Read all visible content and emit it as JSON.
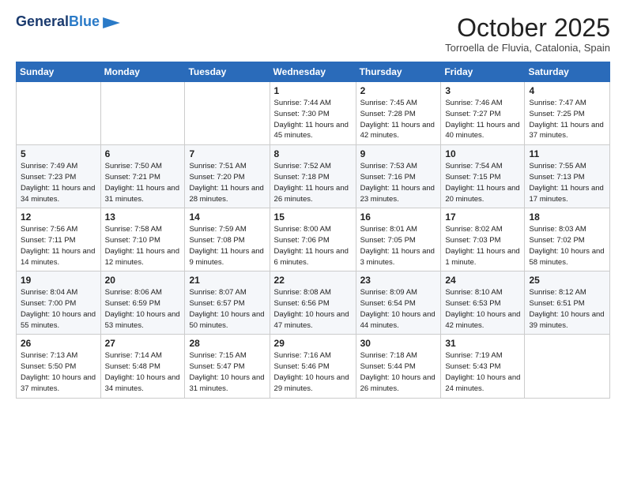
{
  "header": {
    "logo_line1": "General",
    "logo_line2": "Blue",
    "month": "October 2025",
    "location": "Torroella de Fluvia, Catalonia, Spain"
  },
  "weekdays": [
    "Sunday",
    "Monday",
    "Tuesday",
    "Wednesday",
    "Thursday",
    "Friday",
    "Saturday"
  ],
  "weeks": [
    [
      {
        "day": "",
        "detail": ""
      },
      {
        "day": "",
        "detail": ""
      },
      {
        "day": "",
        "detail": ""
      },
      {
        "day": "1",
        "detail": "Sunrise: 7:44 AM\nSunset: 7:30 PM\nDaylight: 11 hours\nand 45 minutes."
      },
      {
        "day": "2",
        "detail": "Sunrise: 7:45 AM\nSunset: 7:28 PM\nDaylight: 11 hours\nand 42 minutes."
      },
      {
        "day": "3",
        "detail": "Sunrise: 7:46 AM\nSunset: 7:27 PM\nDaylight: 11 hours\nand 40 minutes."
      },
      {
        "day": "4",
        "detail": "Sunrise: 7:47 AM\nSunset: 7:25 PM\nDaylight: 11 hours\nand 37 minutes."
      }
    ],
    [
      {
        "day": "5",
        "detail": "Sunrise: 7:49 AM\nSunset: 7:23 PM\nDaylight: 11 hours\nand 34 minutes."
      },
      {
        "day": "6",
        "detail": "Sunrise: 7:50 AM\nSunset: 7:21 PM\nDaylight: 11 hours\nand 31 minutes."
      },
      {
        "day": "7",
        "detail": "Sunrise: 7:51 AM\nSunset: 7:20 PM\nDaylight: 11 hours\nand 28 minutes."
      },
      {
        "day": "8",
        "detail": "Sunrise: 7:52 AM\nSunset: 7:18 PM\nDaylight: 11 hours\nand 26 minutes."
      },
      {
        "day": "9",
        "detail": "Sunrise: 7:53 AM\nSunset: 7:16 PM\nDaylight: 11 hours\nand 23 minutes."
      },
      {
        "day": "10",
        "detail": "Sunrise: 7:54 AM\nSunset: 7:15 PM\nDaylight: 11 hours\nand 20 minutes."
      },
      {
        "day": "11",
        "detail": "Sunrise: 7:55 AM\nSunset: 7:13 PM\nDaylight: 11 hours\nand 17 minutes."
      }
    ],
    [
      {
        "day": "12",
        "detail": "Sunrise: 7:56 AM\nSunset: 7:11 PM\nDaylight: 11 hours\nand 14 minutes."
      },
      {
        "day": "13",
        "detail": "Sunrise: 7:58 AM\nSunset: 7:10 PM\nDaylight: 11 hours\nand 12 minutes."
      },
      {
        "day": "14",
        "detail": "Sunrise: 7:59 AM\nSunset: 7:08 PM\nDaylight: 11 hours\nand 9 minutes."
      },
      {
        "day": "15",
        "detail": "Sunrise: 8:00 AM\nSunset: 7:06 PM\nDaylight: 11 hours\nand 6 minutes."
      },
      {
        "day": "16",
        "detail": "Sunrise: 8:01 AM\nSunset: 7:05 PM\nDaylight: 11 hours\nand 3 minutes."
      },
      {
        "day": "17",
        "detail": "Sunrise: 8:02 AM\nSunset: 7:03 PM\nDaylight: 11 hours\nand 1 minute."
      },
      {
        "day": "18",
        "detail": "Sunrise: 8:03 AM\nSunset: 7:02 PM\nDaylight: 10 hours\nand 58 minutes."
      }
    ],
    [
      {
        "day": "19",
        "detail": "Sunrise: 8:04 AM\nSunset: 7:00 PM\nDaylight: 10 hours\nand 55 minutes."
      },
      {
        "day": "20",
        "detail": "Sunrise: 8:06 AM\nSunset: 6:59 PM\nDaylight: 10 hours\nand 53 minutes."
      },
      {
        "day": "21",
        "detail": "Sunrise: 8:07 AM\nSunset: 6:57 PM\nDaylight: 10 hours\nand 50 minutes."
      },
      {
        "day": "22",
        "detail": "Sunrise: 8:08 AM\nSunset: 6:56 PM\nDaylight: 10 hours\nand 47 minutes."
      },
      {
        "day": "23",
        "detail": "Sunrise: 8:09 AM\nSunset: 6:54 PM\nDaylight: 10 hours\nand 44 minutes."
      },
      {
        "day": "24",
        "detail": "Sunrise: 8:10 AM\nSunset: 6:53 PM\nDaylight: 10 hours\nand 42 minutes."
      },
      {
        "day": "25",
        "detail": "Sunrise: 8:12 AM\nSunset: 6:51 PM\nDaylight: 10 hours\nand 39 minutes."
      }
    ],
    [
      {
        "day": "26",
        "detail": "Sunrise: 7:13 AM\nSunset: 5:50 PM\nDaylight: 10 hours\nand 37 minutes."
      },
      {
        "day": "27",
        "detail": "Sunrise: 7:14 AM\nSunset: 5:48 PM\nDaylight: 10 hours\nand 34 minutes."
      },
      {
        "day": "28",
        "detail": "Sunrise: 7:15 AM\nSunset: 5:47 PM\nDaylight: 10 hours\nand 31 minutes."
      },
      {
        "day": "29",
        "detail": "Sunrise: 7:16 AM\nSunset: 5:46 PM\nDaylight: 10 hours\nand 29 minutes."
      },
      {
        "day": "30",
        "detail": "Sunrise: 7:18 AM\nSunset: 5:44 PM\nDaylight: 10 hours\nand 26 minutes."
      },
      {
        "day": "31",
        "detail": "Sunrise: 7:19 AM\nSunset: 5:43 PM\nDaylight: 10 hours\nand 24 minutes."
      },
      {
        "day": "",
        "detail": ""
      }
    ]
  ]
}
